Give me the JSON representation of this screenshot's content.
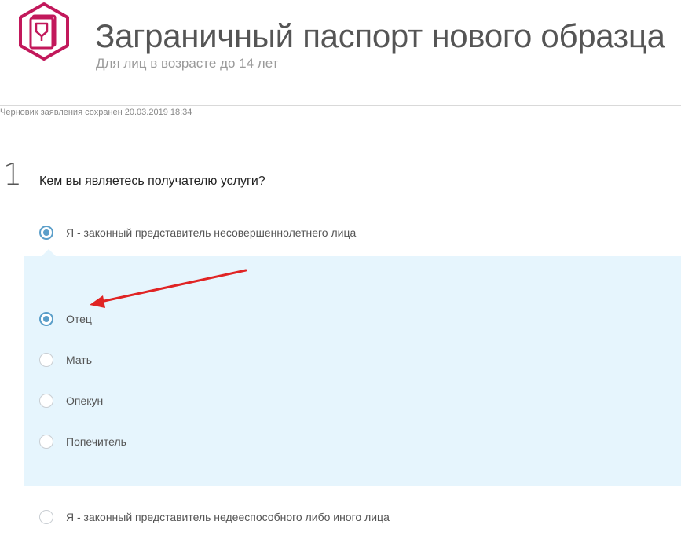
{
  "header": {
    "title": "Заграничный паспорт нового образца",
    "subtitle": "Для лиц в возрасте до 14 лет",
    "logo_icon": "passport-icon",
    "accent_color": "#c2185b"
  },
  "draft_status": "Черновик заявления сохранен 20.03.2019 18:34",
  "step": {
    "number": "1",
    "question": "Кем вы являетесь получателю услуги?"
  },
  "options": {
    "minor_representative": {
      "label": "Я - законный представитель несовершеннолетнего лица",
      "checked": true
    },
    "incapable_representative": {
      "label": "Я - законный представитель недееспособного либо иного лица",
      "checked": false
    }
  },
  "sub_options": [
    {
      "label": "Отец",
      "checked": true
    },
    {
      "label": "Мать",
      "checked": false
    },
    {
      "label": "Опекун",
      "checked": false
    },
    {
      "label": "Попечитель",
      "checked": false
    }
  ],
  "colors": {
    "radio_checked": "#5a9ec9",
    "panel_background": "#e6f5fd",
    "annotation_arrow": "#e02424"
  }
}
